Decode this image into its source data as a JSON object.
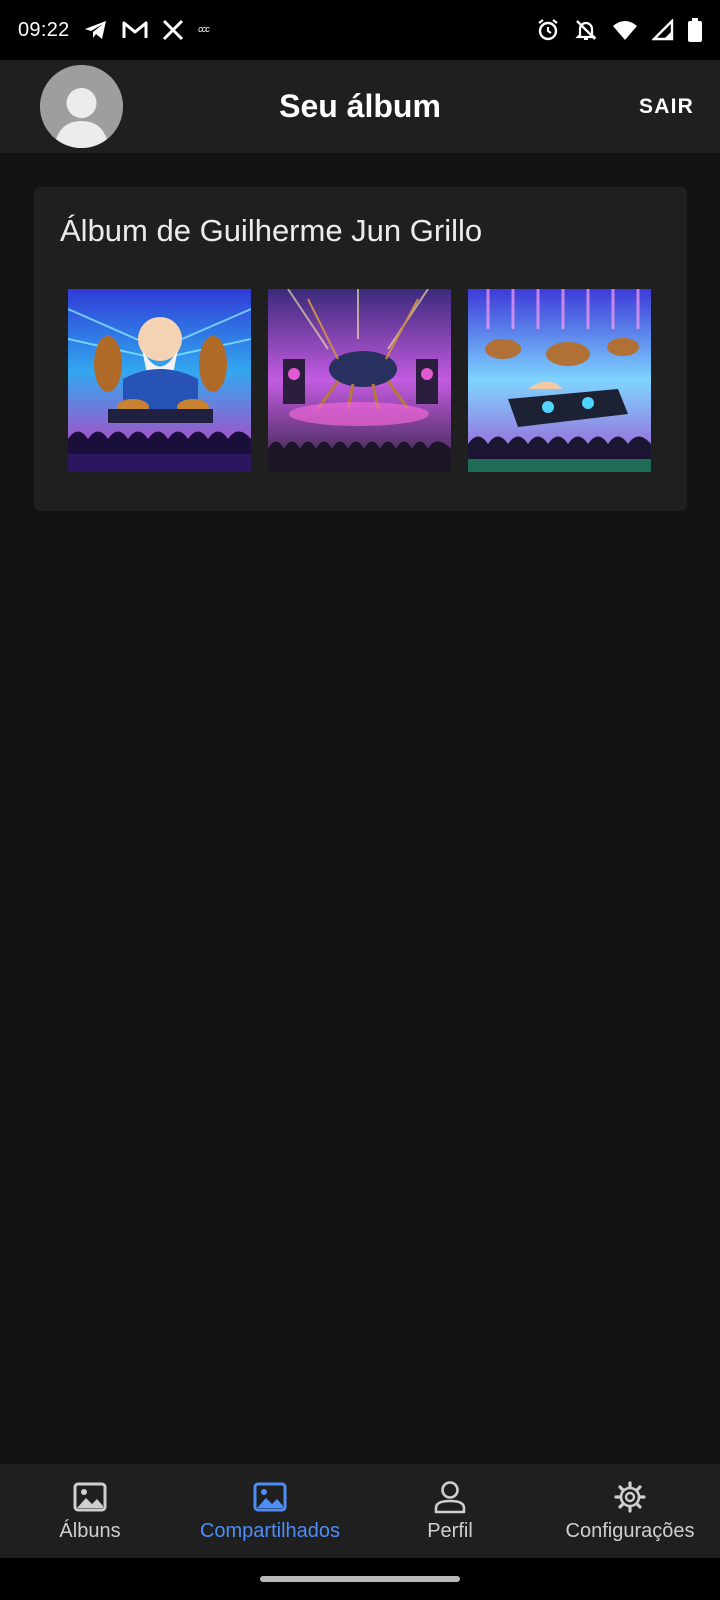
{
  "status_bar": {
    "time": "09:22",
    "left_icons": [
      "telegram-icon",
      "gmail-icon",
      "x-icon",
      "camera-app-icon"
    ],
    "right_icons": [
      "alarm-icon",
      "notifications-off-icon",
      "wifi-icon",
      "signal-icon",
      "battery-icon"
    ],
    "camera_app_text": "ᶜᶜᶜ"
  },
  "app_bar": {
    "title": "Seu álbum",
    "logout_label": "SAIR",
    "avatar_icon": "person-icon"
  },
  "album": {
    "title": "Álbum de Guilherme Jun Grillo",
    "photos": [
      {
        "subject": "crickets-with-dj-at-party"
      },
      {
        "subject": "cricket-on-stage-with-crowd"
      },
      {
        "subject": "crickets-dj-mixer-concert"
      }
    ]
  },
  "bottom_nav": {
    "active_index": 1,
    "items": [
      {
        "label": "Álbuns",
        "icon": "image-icon"
      },
      {
        "label": "Compartilhados",
        "icon": "image-shared-icon"
      },
      {
        "label": "Perfil",
        "icon": "person-outline-icon"
      },
      {
        "label": "Configurações",
        "icon": "gear-icon"
      }
    ]
  },
  "colors": {
    "background": "#131313",
    "surface": "#1f1f1f",
    "accent": "#4c8df6",
    "text_secondary": "#cfcfcf"
  }
}
